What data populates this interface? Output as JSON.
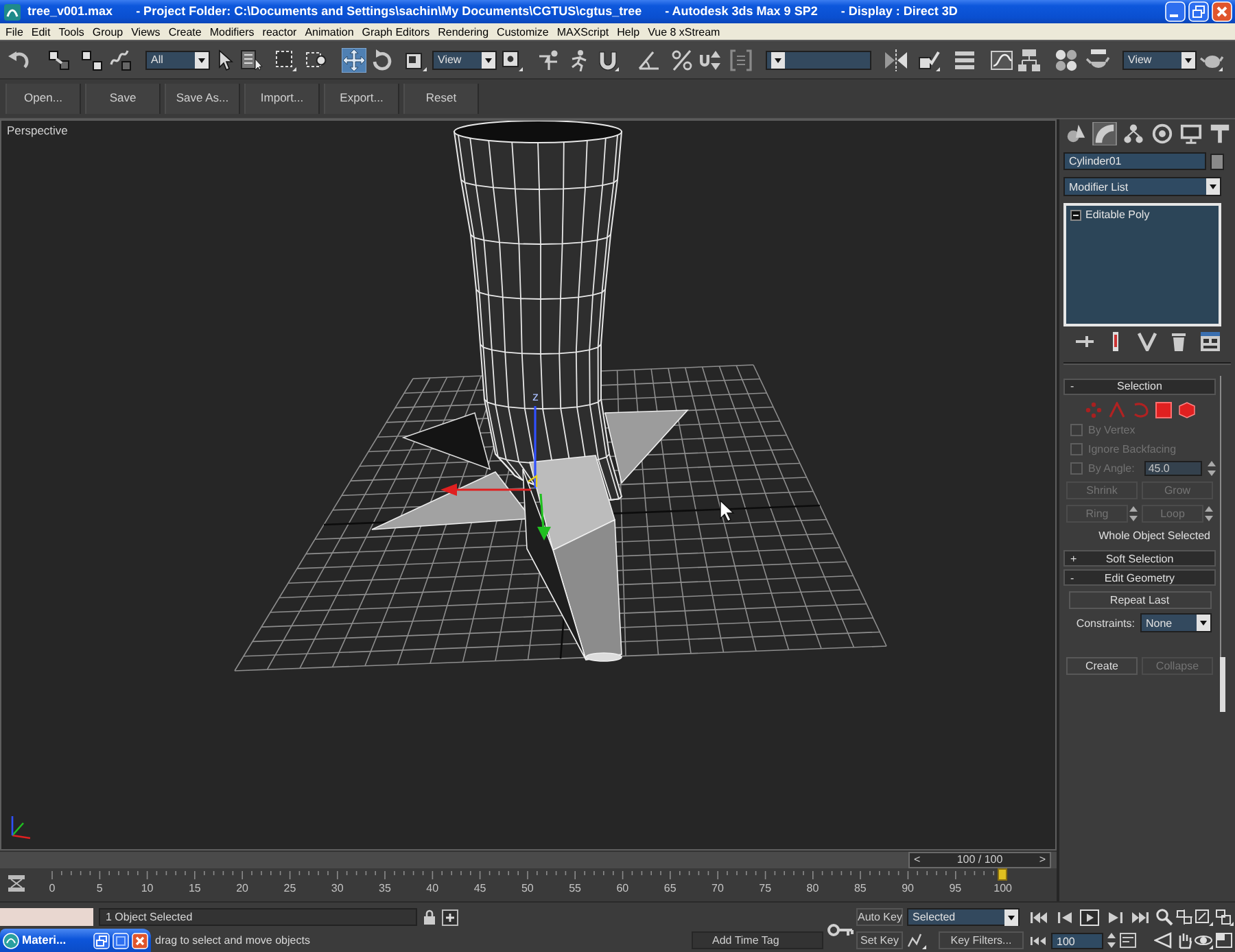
{
  "window": {
    "title_parts": [
      "tree_v001.max",
      "- Project Folder: C:\\Documents and Settings\\sachin\\My Documents\\CGTUS\\cgtus_tree",
      "- Autodesk 3ds Max 9 SP2",
      "- Display : Direct 3D"
    ]
  },
  "menu": [
    "File",
    "Edit",
    "Tools",
    "Group",
    "Views",
    "Create",
    "Modifiers",
    "reactor",
    "Animation",
    "Graph Editors",
    "Rendering",
    "Customize",
    "MAXScript",
    "Help",
    "Vue 8 xStream"
  ],
  "main_toolbar": [
    {
      "kind": "tool",
      "selected": false
    },
    {
      "kind": "tool",
      "selected": false
    },
    {
      "kind": "tool",
      "selected": false
    },
    {
      "kind": "tool",
      "selected": false
    },
    {
      "kind": "dropdown",
      "value": "All"
    },
    {
      "kind": "tool",
      "selected": false
    },
    {
      "kind": "tool",
      "selected": false
    },
    {
      "kind": "tool",
      "selected": false
    },
    {
      "kind": "tool",
      "selected": false
    },
    {
      "kind": "tool",
      "selected": true
    },
    {
      "kind": "tool",
      "selected": false
    },
    {
      "kind": "tool",
      "selected": false
    },
    {
      "kind": "dropdown",
      "value": "View"
    },
    {
      "kind": "tool",
      "selected": false
    },
    {
      "kind": "tool",
      "selected": false
    },
    {
      "kind": "tool",
      "selected": false
    },
    {
      "kind": "tool",
      "selected": false
    },
    {
      "kind": "tool",
      "selected": false
    },
    {
      "kind": "tool",
      "selected": false
    },
    {
      "kind": "tool",
      "selected": false
    },
    {
      "kind": "tool",
      "selected": false
    },
    {
      "kind": "dropdown"
    },
    {
      "kind": "tool",
      "selected": false
    },
    {
      "kind": "tool",
      "selected": false
    },
    {
      "kind": "tool",
      "selected": false
    },
    {
      "kind": "tool",
      "selected": false
    },
    {
      "kind": "tool",
      "selected": false
    },
    {
      "kind": "tool",
      "selected": false
    },
    {
      "kind": "tool",
      "selected": false
    },
    {
      "kind": "dropdown",
      "value": "View"
    },
    {
      "kind": "tool",
      "selected": false
    }
  ],
  "file_toolbar": [
    "Open...",
    "Save",
    "Save As...",
    "Import...",
    "Export...",
    "Reset"
  ],
  "viewport": {
    "label": "Perspective",
    "gizmo_label": "z"
  },
  "command_panel": {
    "tabs": [
      {
        "selected": false
      },
      {
        "selected": true
      },
      {
        "selected": false
      },
      {
        "selected": false
      },
      {
        "selected": false
      },
      {
        "selected": false
      }
    ],
    "object_name": "Cylinder01",
    "modifier_list": "Modifier List",
    "modifier_stack": [
      {
        "label": "Editable Poly"
      }
    ],
    "selection": {
      "toggle": "-",
      "title": "Selection",
      "options": [
        {
          "label": "By Vertex",
          "checked": false,
          "disabled": true
        },
        {
          "label": "Ignore Backfacing",
          "checked": false,
          "disabled": true
        },
        {
          "label": "By Angle:",
          "checked": false,
          "disabled": true,
          "value": "45.0"
        }
      ],
      "buttons": [
        {
          "kind": "button",
          "label": "Shrink",
          "disabled": true
        },
        {
          "kind": "button",
          "label": "Grow",
          "disabled": true
        },
        {
          "kind": "spinner",
          "label": "Ring",
          "disabled": true
        },
        {
          "kind": "spinner",
          "label": "Loop",
          "disabled": true
        }
      ],
      "status": "Whole Object Selected"
    },
    "soft_selection": {
      "toggle": "+",
      "title": "Soft Selection"
    },
    "edit_geometry": {
      "toggle": "-",
      "title": "Edit Geometry",
      "repeat": "Repeat Last",
      "constraints_label": "Constraints:",
      "constraints_value": "None",
      "buttons": [
        {
          "label": "Create",
          "disabled": false
        },
        {
          "label": "Collapse",
          "disabled": true
        }
      ]
    }
  },
  "time_slider": {
    "prev": "<",
    "value": "100 / 100",
    "next": ">",
    "level": 1
  },
  "track_bar": {
    "ticks": [
      "0",
      "5",
      "10",
      "15",
      "20",
      "25",
      "30",
      "35",
      "40",
      "45",
      "50",
      "55",
      "60",
      "65",
      "70",
      "75",
      "80",
      "85",
      "90",
      "95",
      "100"
    ]
  },
  "status_bar": {
    "selection_info": "1 Object Selected",
    "prompt": "drag to select and move objects",
    "time_tag": "Add Time Tag",
    "auto_key": "Auto Key",
    "key_mode": "Selected",
    "set_key": "Set Key",
    "key_filters": "Key Filters...",
    "frame": "100"
  },
  "minimized_window": {
    "title": "Materi..."
  }
}
